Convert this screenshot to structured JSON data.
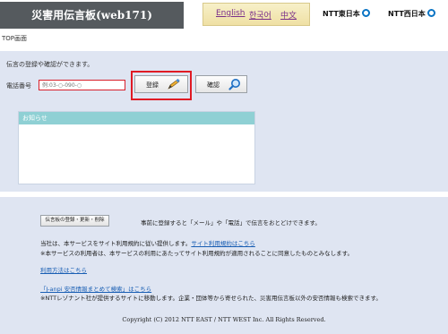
{
  "header": {
    "title": "災害用伝言板(web171)",
    "languages": [
      "English",
      "한국어",
      "中文"
    ],
    "ntt_east": "NTT東日本",
    "ntt_west": "NTT西日本"
  },
  "breadcrumb": "TOP画面",
  "main": {
    "intro": "伝言の登録や確認ができます。",
    "phone_label": "電話番号",
    "phone_placeholder": "例:03-○-090-○",
    "register_label": "登録",
    "confirm_label": "確認",
    "notice_title": "お知らせ"
  },
  "footer": {
    "prereg_button": "伝言板の登録・更新・削除",
    "prereg_text": "事前に登録すると「メール」や「電話」で伝言をおとどけできます。",
    "terms_text": "当社は、本サービスをサイト利用規約に従い提供します。",
    "terms_link": "サイト利用規約はこちら",
    "terms_note": "※本サービスの利用者は、本サービスの利用にあたってサイト利用規約が適用されることに同意したものとみなします。",
    "howto_link": "利用方法はこちら",
    "janpi_link": "「J-anpi 安否情報まとめて検索」はこちら",
    "janpi_note": "※NTTレゾナント社が提供するサイトに移動します。企業・団体等から寄せられた、災害用伝言板以外の安否情報も検索できます。",
    "copyright": "Copyright (C) 2012 NTT EAST / NTT WEST Inc. All Rights Reserved."
  },
  "colors": {
    "title_bg": "#555a5e",
    "highlight": "#e01b24",
    "panel_bg": "#dfe5f2",
    "notice_bar": "#8fd0d4",
    "ntt_logo": "#0a74c4"
  }
}
